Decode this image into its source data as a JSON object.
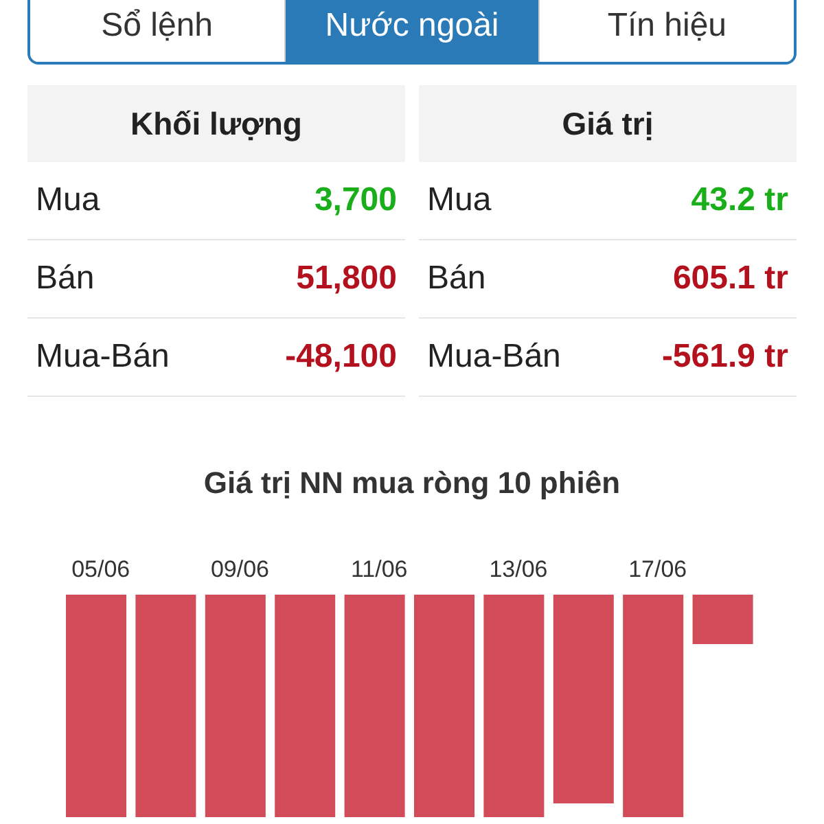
{
  "tabs": [
    {
      "label": "Sổ lệnh",
      "selected": false
    },
    {
      "label": "Nước ngoài",
      "selected": true
    },
    {
      "label": "Tín hiệu",
      "selected": false
    }
  ],
  "tables": [
    {
      "heading": "Khối lượng",
      "rows": [
        {
          "label": "Mua",
          "value": "3,700",
          "color": "#1aae1a"
        },
        {
          "label": "Bán",
          "value": "51,800",
          "color": "#b3111d"
        },
        {
          "label": "Mua-Bán",
          "value": "-48,100",
          "color": "#b3111d"
        }
      ]
    },
    {
      "heading": "Giá trị",
      "rows": [
        {
          "label": "Mua",
          "value": "43.2 tr",
          "color": "#1aae1a"
        },
        {
          "label": "Bán",
          "value": "605.1 tr",
          "color": "#b3111d"
        },
        {
          "label": "Mua-Bán",
          "value": "-561.9 tr",
          "color": "#b3111d"
        }
      ]
    }
  ],
  "chart": {
    "title": "Giá trị NN mua ròng 10 phiên",
    "date_labels": [
      "05/06",
      "09/06",
      "11/06",
      "13/06",
      "17/06"
    ]
  }
}
